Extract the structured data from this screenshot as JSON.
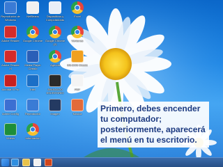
{
  "desktop_icons": [
    {
      "label": "Reproductor de Windows",
      "icon": "media-player-icon",
      "color": "#3a7bd5"
    },
    {
      "label": "NetBeans",
      "icon": "netbeans-icon",
      "color": "#f0f0f0"
    },
    {
      "label": "Dispositivos y Computadoras",
      "icon": "computer-icon",
      "color": "#e8eef8"
    },
    {
      "label": "Excel",
      "icon": "chrome-icon",
      "color": "#e8453c"
    },
    {
      "label": "Adobe Reader",
      "icon": "pdf-icon",
      "color": "#d42b2b"
    },
    {
      "label": "Google Chrome",
      "icon": "chrome-icon",
      "color": "#e8453c"
    },
    {
      "label": "Google Chrome (2)",
      "icon": "chrome-icon",
      "color": "#e8453c"
    },
    {
      "label": "Ventanas",
      "icon": "chrome-icon",
      "color": "#e8453c"
    },
    {
      "label": "Adobe Reader XI",
      "icon": "pdf-icon",
      "color": "#d42b2b"
    },
    {
      "label": "Media Player Classic",
      "icon": "media-player-icon",
      "color": "#2a5fb8"
    },
    {
      "label": "Agenda",
      "icon": "chrome-icon",
      "color": "#e8453c"
    },
    {
      "label": "MS-DOS Classic",
      "icon": "dos-icon",
      "color": "#f0a020"
    },
    {
      "label": "Acrobat X Pro",
      "icon": "acrobat-icon",
      "color": "#c8201f"
    },
    {
      "label": "Intel",
      "icon": "monitor-icon",
      "color": "#1b6fc6"
    },
    {
      "label": "AVANZADO ESCRITORIO",
      "icon": "app-icon",
      "color": "#2a2a2a"
    },
    {
      "label": "PDF",
      "icon": "document-icon",
      "color": "#f4f4f4"
    },
    {
      "label": "Admin Config",
      "icon": "settings-icon",
      "color": "#3c6fd2"
    },
    {
      "label": "Reproductor",
      "icon": "media-player-icon",
      "color": "#3a7bd5"
    },
    {
      "label": "Imagen",
      "icon": "image-icon",
      "color": "#243a62"
    },
    {
      "label": "Música",
      "icon": "folder-icon",
      "color": "#e26b3a"
    },
    {
      "label": "Videos",
      "icon": "video-icon",
      "color": "#1d8e3a"
    },
    {
      "label": "Información",
      "icon": "chrome-icon",
      "color": "#e8453c"
    }
  ],
  "caption": {
    "line1": "Primero, debes encender",
    "line2": "tu computador;",
    "line3": "posteriormente, aparecerá",
    "line4": "el  menú en tu escritorio."
  },
  "taskbar": {
    "items": [
      {
        "icon": "internet-explorer-icon",
        "color": "#2f8ee0"
      },
      {
        "icon": "file-explorer-icon",
        "color": "#e8c24a"
      },
      {
        "icon": "media-player-icon",
        "color": "#f1f1f1"
      },
      {
        "icon": "powerpoint-icon",
        "color": "#d0451b"
      }
    ]
  },
  "colors": {
    "desktop_background": "#1e86e4",
    "caption_text": "#1c3a80",
    "flower_center": "#f4c31c",
    "taskbar": "#274f86"
  }
}
